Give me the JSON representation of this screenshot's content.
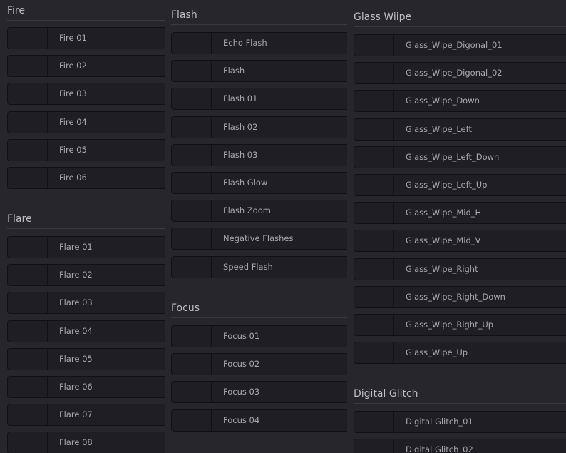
{
  "columns": [
    {
      "sections": [
        {
          "title": "Fire",
          "items": [
            "Fire 01",
            "Fire 02",
            "Fire 03",
            "Fire 04",
            "Fire 05",
            "Fire 06"
          ]
        },
        {
          "title": "Flare",
          "items": [
            "Flare 01",
            "Flare 02",
            "Flare 03",
            "Flare 04",
            "Flare 05",
            "Flare 06",
            "Flare 07",
            "Flare 08"
          ]
        }
      ]
    },
    {
      "sections": [
        {
          "title": "Flash",
          "items": [
            "Echo Flash",
            "Flash",
            "Flash 01",
            "Flash 02",
            "Flash 03",
            "Flash Glow",
            "Flash Zoom",
            "Negative Flashes",
            "Speed Flash"
          ]
        },
        {
          "title": "Focus",
          "items": [
            "Focus 01",
            "Focus 02",
            "Focus 03",
            "Focus 04"
          ]
        }
      ]
    },
    {
      "sections": [
        {
          "title": "Glass Wiipe",
          "items": [
            "Glass_Wipe_Digonal_01",
            "Glass_Wipe_Digonal_02",
            "Glass_Wipe_Down",
            "Glass_Wipe_Left",
            "Glass_Wipe_Left_Down",
            "Glass_Wipe_Left_Up",
            "Glass_Wipe_Mid_H",
            "Glass_Wipe_Mid_V",
            "Glass_Wipe_Right",
            "Glass_Wipe_Right_Down",
            "Glass_Wipe_Right_Up",
            "Glass_Wipe_Up"
          ]
        },
        {
          "title": "Digital Glitch",
          "items": [
            "Digital Glitch_01",
            "Digital Glitch_02"
          ]
        }
      ]
    }
  ]
}
